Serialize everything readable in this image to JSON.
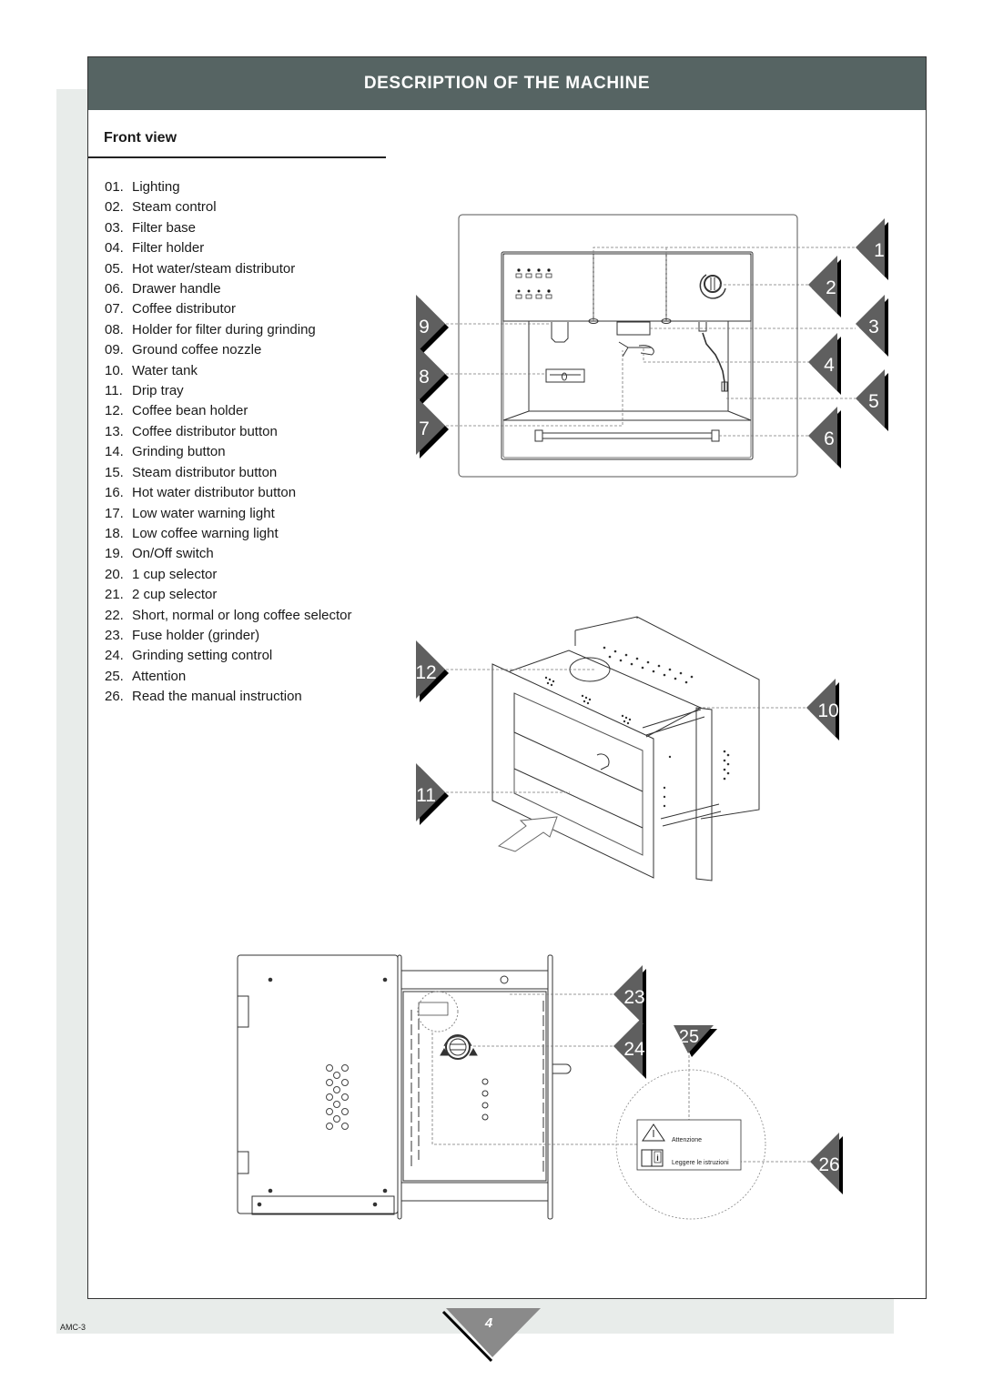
{
  "header": {
    "title": "DESCRIPTION OF THE MACHINE"
  },
  "section": {
    "title": "Front view"
  },
  "legend": [
    {
      "num": "01.",
      "label": "Lighting"
    },
    {
      "num": "02.",
      "label": "Steam control"
    },
    {
      "num": "03.",
      "label": "Filter base"
    },
    {
      "num": "04.",
      "label": "Filter holder"
    },
    {
      "num": "05.",
      "label": "Hot water/steam distributor"
    },
    {
      "num": "06.",
      "label": "Drawer handle"
    },
    {
      "num": "07.",
      "label": "Coffee distributor"
    },
    {
      "num": "08.",
      "label": "Holder for filter during grinding"
    },
    {
      "num": "09.",
      "label": "Ground coffee nozzle"
    },
    {
      "num": "10.",
      "label": "Water tank"
    },
    {
      "num": "11.",
      "label": "Drip tray"
    },
    {
      "num": "12.",
      "label": "Coffee bean holder"
    },
    {
      "num": "13.",
      "label": "Coffee distributor button"
    },
    {
      "num": "14.",
      "label": "Grinding button"
    },
    {
      "num": "15.",
      "label": "Steam distributor button"
    },
    {
      "num": "16.",
      "label": "Hot water distributor button"
    },
    {
      "num": "17.",
      "label": "Low water warning light"
    },
    {
      "num": "18.",
      "label": "Low coffee warning light"
    },
    {
      "num": "19.",
      "label": "On/Off switch"
    },
    {
      "num": "20.",
      "label": "1 cup selector"
    },
    {
      "num": "21.",
      "label": "2 cup selector"
    },
    {
      "num": "22.",
      "label": "Short, normal or long coffee selector"
    },
    {
      "num": "23.",
      "label": "Fuse holder (grinder)"
    },
    {
      "num": "24.",
      "label": "Grinding setting control"
    },
    {
      "num": "25.",
      "label": "Attention"
    },
    {
      "num": "26.",
      "label": "Read the manual instruction"
    }
  ],
  "callouts": {
    "front": [
      "1",
      "2",
      "3",
      "4",
      "5",
      "6",
      "7",
      "8",
      "9"
    ],
    "perspective": [
      "10",
      "11",
      "12"
    ],
    "top": [
      "23",
      "24",
      "25",
      "26"
    ]
  },
  "label_sticker": {
    "attention": "Attenzione",
    "read": "Leggere le istruzioni"
  },
  "footer": {
    "code": "AMC-3",
    "page": "4"
  },
  "colors": {
    "header_bg": "#566463",
    "marker": "#5f5f5f",
    "band": "#e8ecea"
  }
}
